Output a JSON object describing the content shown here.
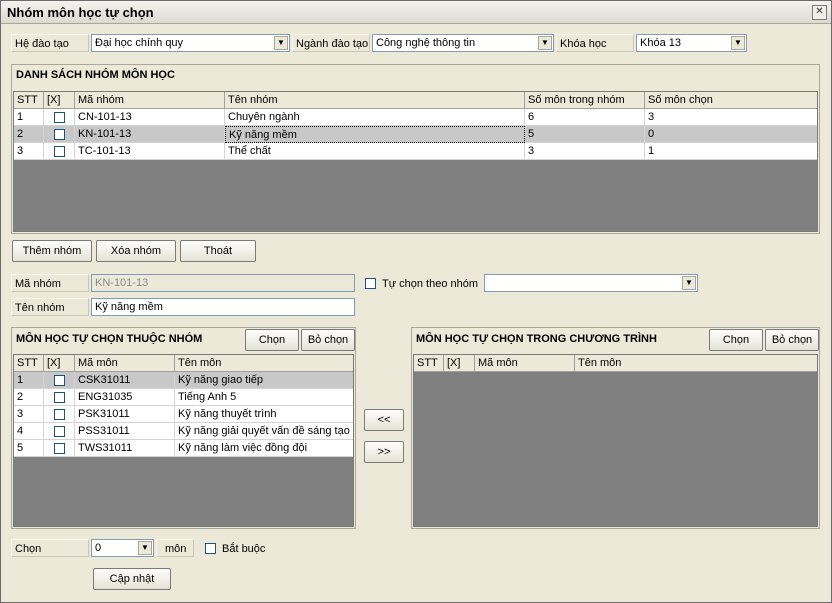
{
  "window": {
    "title": "Nhóm môn học tự chọn",
    "close_symbol": "✕"
  },
  "filters": {
    "he_dao_tao": {
      "label": "Hệ đào tạo",
      "value": "Đại học chính quy"
    },
    "nganh_dao_tao": {
      "label": "Ngành đào tạo",
      "value": "Công nghệ thông tin"
    },
    "khoa_hoc": {
      "label": "Khóa học",
      "value": "Khóa 13"
    }
  },
  "group_list": {
    "title": "DANH SÁCH NHÓM MÔN HỌC",
    "columns": [
      "STT",
      "[X]",
      "Mã nhóm",
      "Tên nhóm",
      "Số môn trong nhóm",
      "Số môn chọn"
    ],
    "rows": [
      {
        "stt": "1",
        "ma": "CN-101-13",
        "ten": "Chuyên ngành",
        "so_mon": "6",
        "so_chon": "3"
      },
      {
        "stt": "2",
        "ma": "KN-101-13",
        "ten": "Kỹ năng mềm",
        "so_mon": "5",
        "so_chon": "0"
      },
      {
        "stt": "3",
        "ma": "TC-101-13",
        "ten": "Thể chất",
        "so_mon": "3",
        "so_chon": "1"
      }
    ]
  },
  "actions": {
    "add": "Thêm nhóm",
    "delete": "Xóa nhóm",
    "exit": "Thoát"
  },
  "form": {
    "ma_nhom_label": "Mã nhóm",
    "ma_nhom_value": "KN-101-13",
    "ten_nhom_label": "Tên nhóm",
    "ten_nhom_value": "Kỹ năng mềm",
    "tu_chon_label": "Tự chọn theo nhóm",
    "tu_chon_value": ""
  },
  "group_subjects": {
    "title": "MÔN HỌC TỰ CHỌN THUỘC NHÓM",
    "select": "Chọn",
    "deselect": "Bỏ chọn",
    "columns": [
      "STT",
      "[X]",
      "Mã môn",
      "Tên môn"
    ],
    "rows": [
      {
        "stt": "1",
        "ma": "CSK31011",
        "ten": "Kỹ năng giao tiếp"
      },
      {
        "stt": "2",
        "ma": "ENG31035",
        "ten": "Tiếng Anh 5"
      },
      {
        "stt": "3",
        "ma": "PSK31011",
        "ten": "Kỹ năng thuyết trình"
      },
      {
        "stt": "4",
        "ma": "PSS31011",
        "ten": "Kỹ năng giải quyết vấn đề sáng tạo"
      },
      {
        "stt": "5",
        "ma": "TWS31011",
        "ten": "Kỹ năng làm việc đồng đội"
      }
    ]
  },
  "transfer": {
    "left": "<<",
    "right": ">>"
  },
  "program_subjects": {
    "title": "MÔN HỌC TỰ CHỌN TRONG CHƯƠNG TRÌNH",
    "select": "Chọn",
    "deselect": "Bỏ chọn",
    "columns": [
      "STT",
      "[X]",
      "Mã môn",
      "Tên môn"
    ]
  },
  "bottom": {
    "chon_label": "Chọn",
    "chon_value": "0",
    "unit": "môn",
    "required_label": "Bắt buộc",
    "update": "Cập nhật"
  }
}
